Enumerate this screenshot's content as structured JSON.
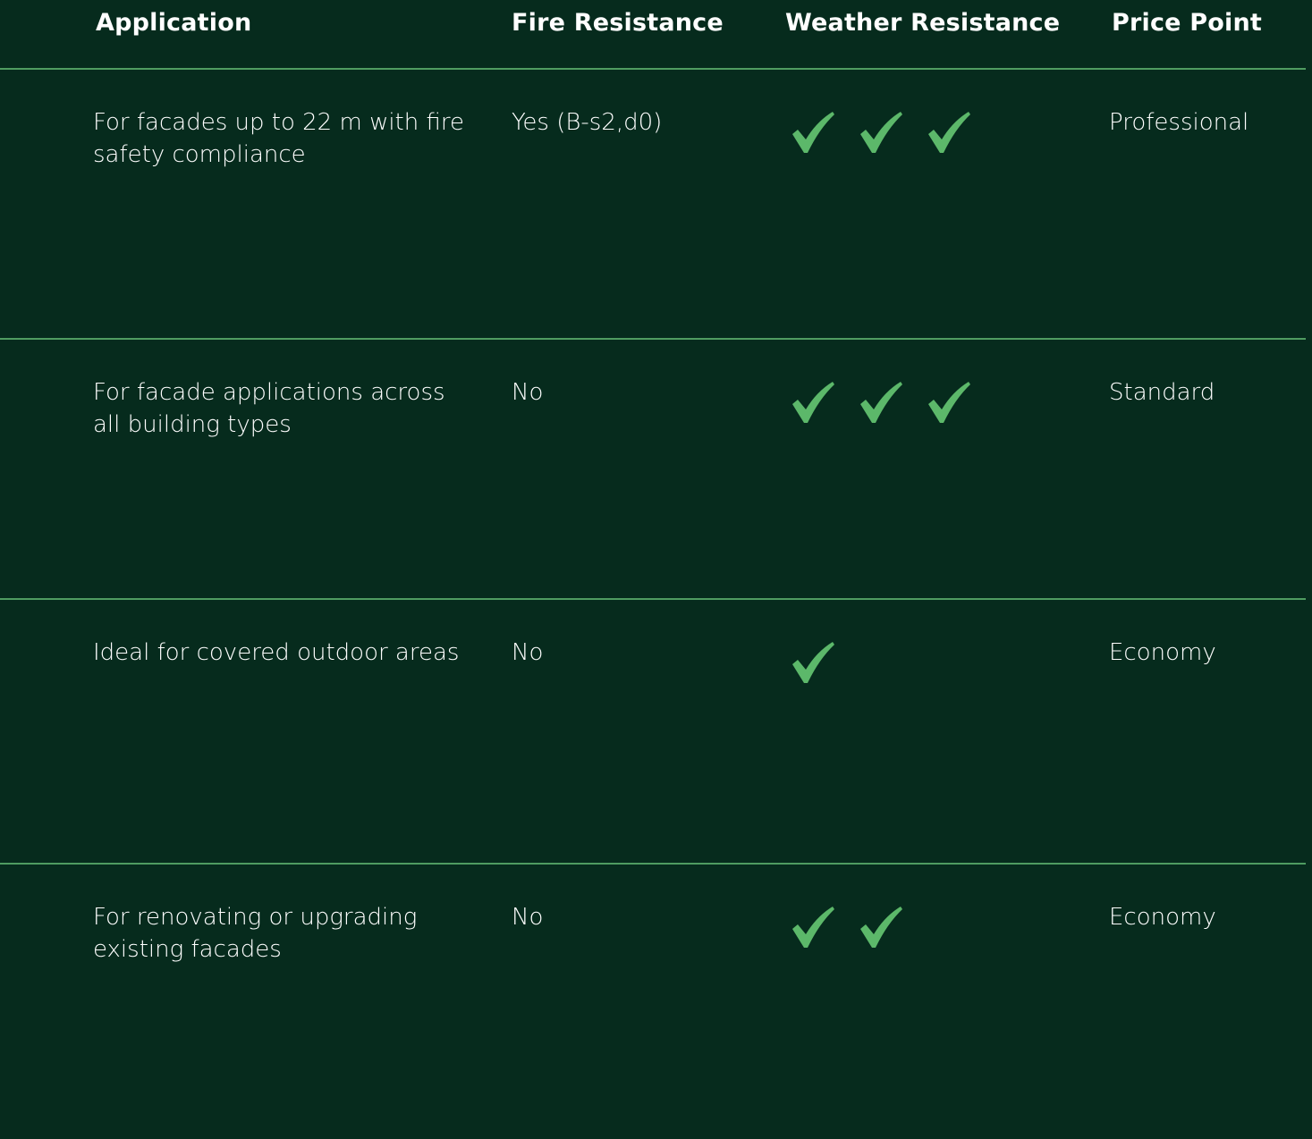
{
  "table": {
    "headers": {
      "application": "Application",
      "fire_resistance": "Fire Resistance",
      "weather_resistance": "Weather Resistance",
      "price_point": "Price Point"
    },
    "rows": [
      {
        "application": "For facades up to 22 m with fire safety compliance",
        "fire_resistance": "Yes (B-s2,d0)",
        "weather_checks": 3,
        "price_point": "Professional"
      },
      {
        "application": "For facade applications across all building types",
        "fire_resistance": "No",
        "weather_checks": 3,
        "price_point": "Standard"
      },
      {
        "application": "Ideal for covered outdoor areas",
        "fire_resistance": "No",
        "weather_checks": 1,
        "price_point": "Economy"
      },
      {
        "application": "For renovating or upgrading existing facades",
        "fire_resistance": "No",
        "weather_checks": 2,
        "price_point": "Economy"
      }
    ]
  },
  "colors": {
    "background": "#062b1d",
    "divider": "#4f9c61",
    "check": "#5cb86a",
    "text": "#ffffff"
  },
  "icons": {
    "weather_rating": "check-icon"
  }
}
